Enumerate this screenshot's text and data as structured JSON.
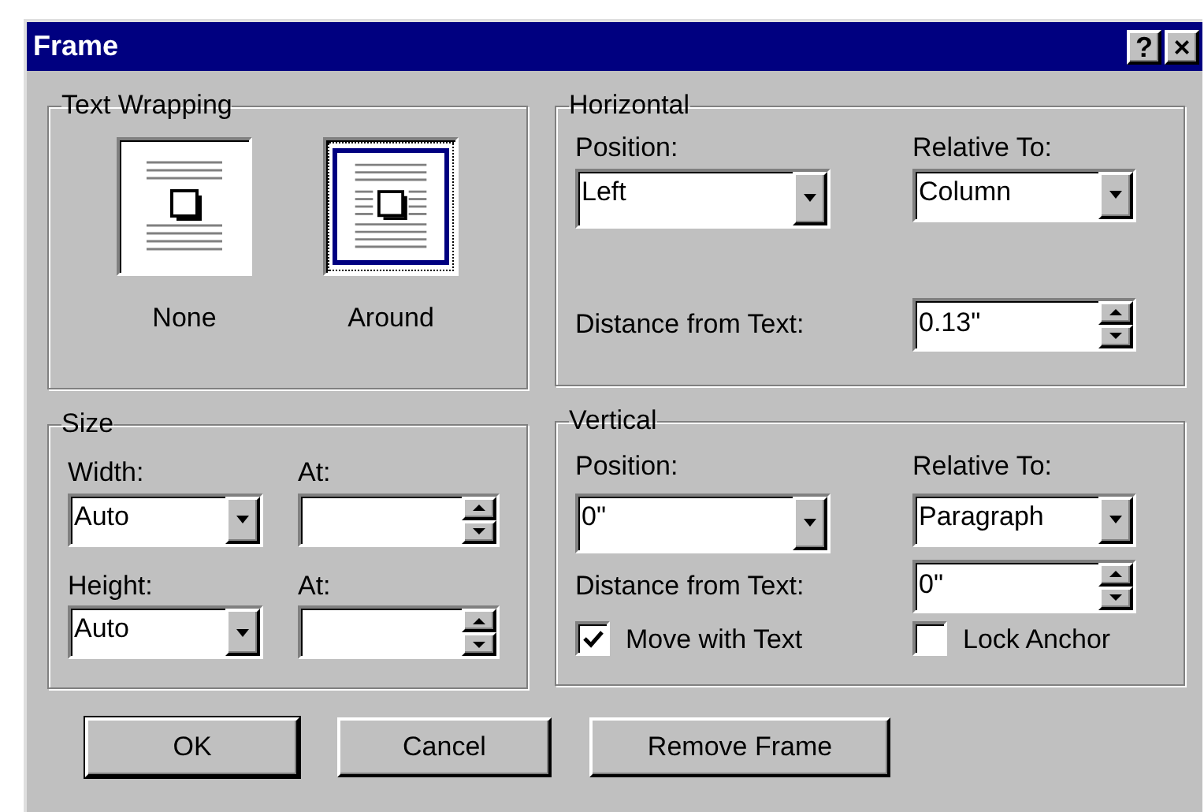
{
  "window": {
    "title": "Frame",
    "controls": [
      "?",
      "×"
    ]
  },
  "text_wrapping": {
    "title": "Text Wrapping",
    "options": [
      {
        "label": "None",
        "kind": "none",
        "selected": false
      },
      {
        "label": "Around",
        "kind": "around",
        "selected": true
      }
    ]
  },
  "horizontal": {
    "title": "Horizontal",
    "position": {
      "label": "Position:",
      "value": "Left"
    },
    "relative_to": {
      "label": "Relative To:",
      "value": "Column"
    },
    "distance": {
      "label": "Distance from Text:",
      "value": "0.13\""
    }
  },
  "size": {
    "title": "Size",
    "width": {
      "label": "Width:",
      "value": "Auto"
    },
    "width_at": {
      "label": "At:"
    },
    "height": {
      "label": "Height:",
      "value": "Auto"
    },
    "height_at": {
      "label": "At:"
    }
  },
  "vertical": {
    "title": "Vertical",
    "position": {
      "label": "Position:",
      "value": "0\""
    },
    "relative_to": {
      "label": "Relative To:",
      "value": "Paragraph"
    },
    "distance": {
      "label": "Distance from Text:",
      "value": "0\""
    },
    "checkboxes": [
      {
        "label": "Move with Text",
        "checked": true
      },
      {
        "label": "Lock Anchor",
        "checked": false
      }
    ]
  },
  "buttons": [
    {
      "label": "OK",
      "default": true
    },
    {
      "label": "Cancel",
      "default": false
    },
    {
      "label": "Remove Frame",
      "default": false
    }
  ]
}
